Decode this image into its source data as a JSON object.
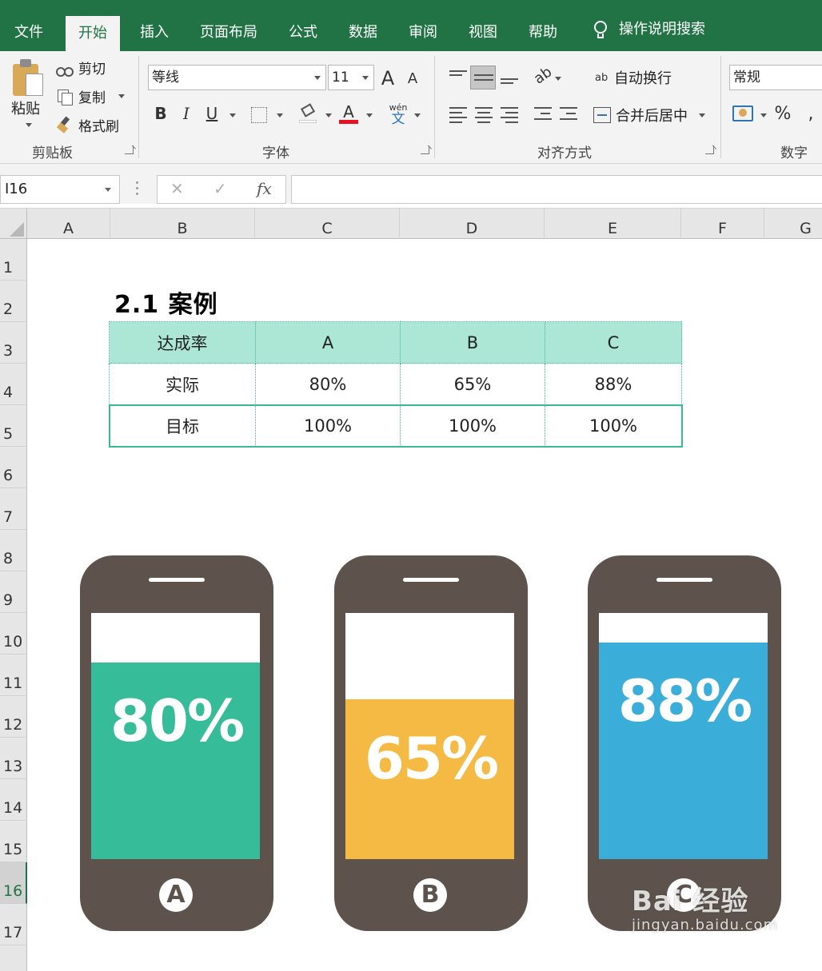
{
  "ribbon_tabs": [
    "文件",
    "开始",
    "插入",
    "页面布局",
    "公式",
    "数据",
    "审阅",
    "视图",
    "帮助",
    "操作说明搜索"
  ],
  "active_tab": "开始",
  "clipboard": {
    "paste": "粘贴",
    "cut": "剪切",
    "copy": "复制",
    "format_painter": "格式刷",
    "label": "剪贴板"
  },
  "font": {
    "family": "等线",
    "size": "11",
    "label": "字体",
    "bold": "B",
    "italic": "I",
    "underline": "U",
    "grow": "A",
    "shrink": "A",
    "color_a": "A",
    "phonetic_top": "wén",
    "phonetic_bottom": "文"
  },
  "alignment": {
    "wrap_text": "自动换行",
    "merge_center": "合并后居中",
    "label": "对齐方式",
    "wrap_icon": "ab"
  },
  "number": {
    "format": "常规",
    "percent": "%",
    "label": "数字"
  },
  "formula_bar": {
    "name_box": "I16",
    "fx": "fx",
    "cancel": "✕",
    "enter": "✓",
    "value": ""
  },
  "columns": [
    "A",
    "B",
    "C",
    "D",
    "E",
    "F",
    "G"
  ],
  "rows": [
    "1",
    "2",
    "3",
    "4",
    "5",
    "6",
    "7",
    "8",
    "9",
    "10",
    "11",
    "12",
    "13",
    "14",
    "15",
    "16",
    "17"
  ],
  "active_row": "16",
  "sheet": {
    "title": "2.1 案例",
    "table": {
      "header": [
        "达成率",
        "A",
        "B",
        "C"
      ],
      "actual": [
        "实际",
        "80%",
        "65%",
        "88%"
      ],
      "target": [
        "目标",
        "100%",
        "100%",
        "100%"
      ]
    },
    "phones": [
      {
        "label": "80%",
        "badge": "A",
        "fill_fraction": 0.8,
        "color": "#37bc99"
      },
      {
        "label": "65%",
        "badge": "B",
        "fill_fraction": 0.65,
        "color": "#f4ba43"
      },
      {
        "label": "88%",
        "badge": "C",
        "fill_fraction": 0.88,
        "color": "#3badd9"
      }
    ]
  },
  "colors": {
    "excel_green": "#217346",
    "table_header": "#ace6d5",
    "table_border": "#3ab795",
    "phone_body": "#5d534c"
  },
  "watermark": {
    "line1": "Bai 经验",
    "line2": "jingyan.baidu.com"
  }
}
